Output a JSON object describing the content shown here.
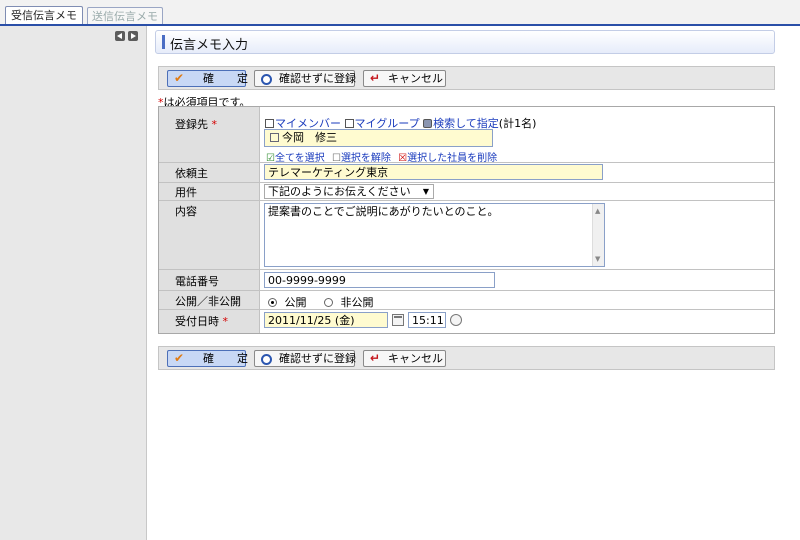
{
  "tabs": [
    {
      "label": "受信伝言メモ",
      "active": true
    },
    {
      "label": "送信伝言メモ",
      "active": false
    }
  ],
  "page_title": "伝言メモ入力",
  "actions": {
    "confirm": "確　定",
    "register_without_confirm": "確認せずに登録",
    "cancel": "キャンセル"
  },
  "required_note": "は必須項目です。",
  "required_mark": "*",
  "form": {
    "recipient": {
      "label": "登録先",
      "my_members": "マイメンバー",
      "my_groups": "マイグループ",
      "search_assign": "検索して指定",
      "count": "(計1名)",
      "selected": [
        "今岡　修三"
      ],
      "select_all": "全てを選択",
      "deselect": "選択を解除",
      "delete_selected": "選択した社員を削除"
    },
    "requester": {
      "label": "依頼主",
      "value": "テレマーケティング東京"
    },
    "subject": {
      "label": "用件",
      "value": "下記のようにお伝えください"
    },
    "content": {
      "label": "内容",
      "value": "提案書のことでご説明にあがりたいとのこと。"
    },
    "phone": {
      "label": "電話番号",
      "value": "00-9999-9999"
    },
    "visibility": {
      "label": "公開／非公開",
      "options": [
        "公開",
        "非公開"
      ],
      "selected": "公開"
    },
    "received_at": {
      "label": "受付日時",
      "date": "2011/11/25 (金)",
      "time": "15:11"
    }
  },
  "colors": {
    "accent": "#2a4fa8",
    "required": "#d40000",
    "link": "#1a3bbd"
  }
}
